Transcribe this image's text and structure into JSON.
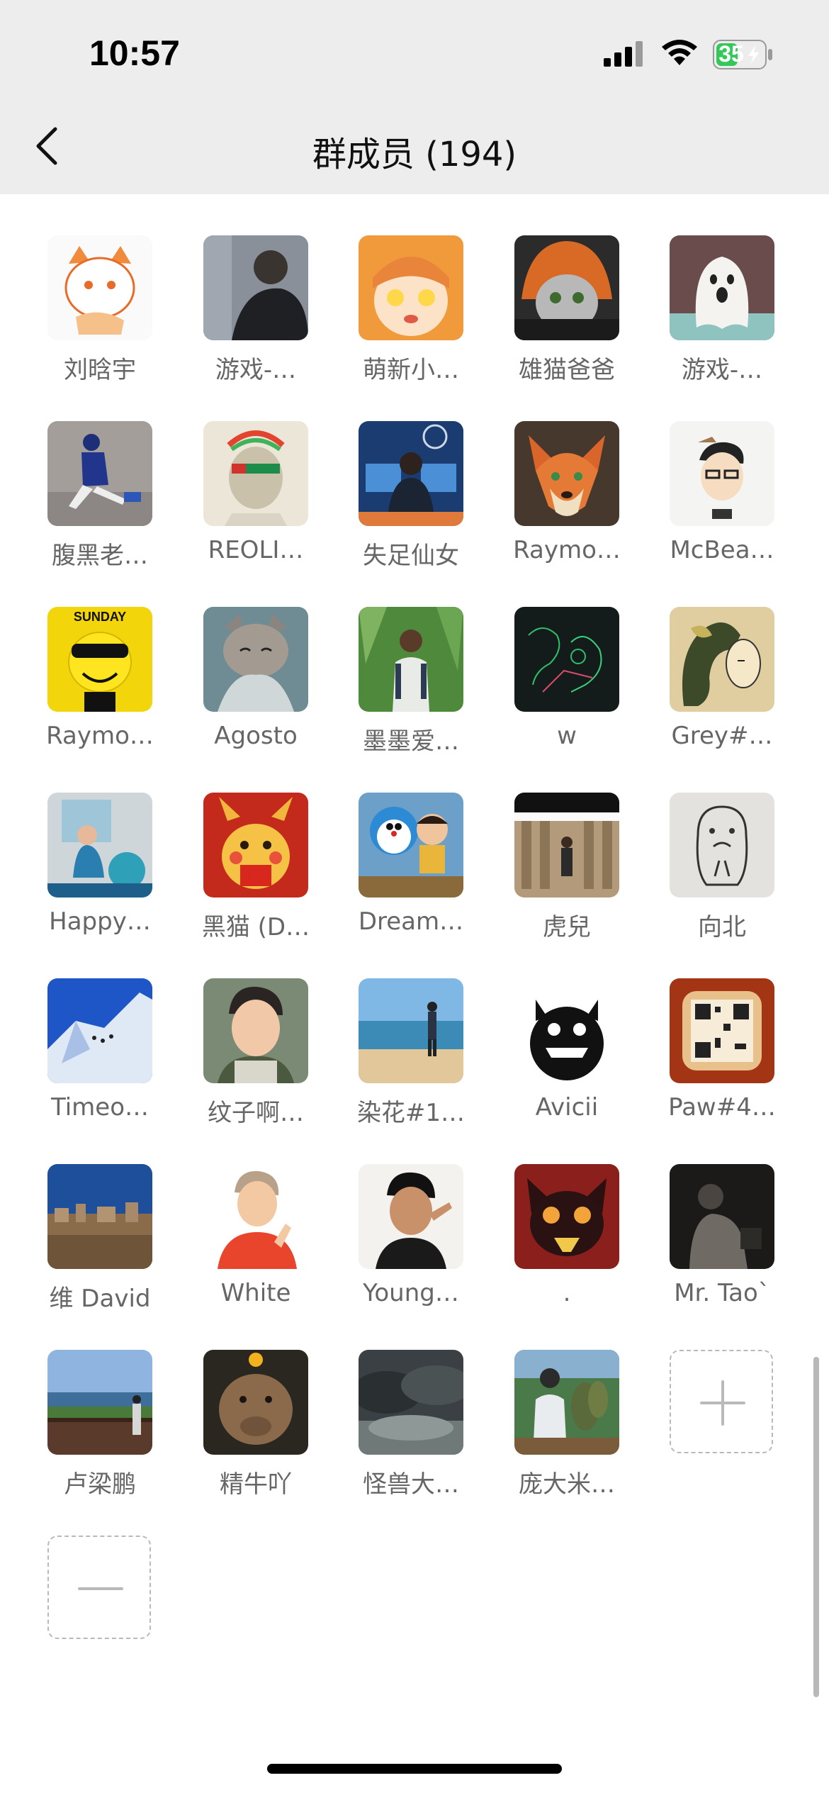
{
  "status_bar": {
    "time": "10:57",
    "battery": "35"
  },
  "nav": {
    "title": "群成员 (194)"
  },
  "members": [
    {
      "name": "刘晗宇",
      "avatar": "white-fox-cartoon-icon"
    },
    {
      "name": "游戏-…",
      "avatar": "person-hoodie-photo-icon"
    },
    {
      "name": "萌新小…",
      "avatar": "umaru-anime-icon"
    },
    {
      "name": "雄猫爸爸",
      "avatar": "cat-helmet-icon"
    },
    {
      "name": "游戏-…",
      "avatar": "ghost-icon"
    },
    {
      "name": "腹黑老…",
      "avatar": "sitting-figure-icon"
    },
    {
      "name": "REOLI…",
      "avatar": "ape-nft-icon"
    },
    {
      "name": "失足仙女",
      "avatar": "desk-computer-icon"
    },
    {
      "name": "Raymo…",
      "avatar": "fox-nick-icon"
    },
    {
      "name": "McBea…",
      "avatar": "glasses-man-cartoon-icon"
    },
    {
      "name": "Raymo…",
      "avatar": "sunday-smiley-icon"
    },
    {
      "name": "Agosto",
      "avatar": "tabby-cat-icon"
    },
    {
      "name": "墨墨爱…",
      "avatar": "person-greenery-icon"
    },
    {
      "name": "w",
      "avatar": "neon-sketch-icon"
    },
    {
      "name": "Grey#…",
      "avatar": "botanical-face-icon"
    },
    {
      "name": "Happy…",
      "avatar": "child-room-icon"
    },
    {
      "name": "黑猫 (D…",
      "avatar": "pikachu-icon"
    },
    {
      "name": "Dream…",
      "avatar": "doraemon-icon"
    },
    {
      "name": "虎兒",
      "avatar": "temple-columns-icon"
    },
    {
      "name": "向北",
      "avatar": "seal-doodle-icon"
    },
    {
      "name": "Timeo…",
      "avatar": "mountain-snow-icon"
    },
    {
      "name": "纹子啊…",
      "avatar": "young-man-selfie-icon"
    },
    {
      "name": "染花#1…",
      "avatar": "beach-person-icon"
    },
    {
      "name": "Avicii",
      "avatar": "black-monster-icon"
    },
    {
      "name": "Paw#4…",
      "avatar": "qr-toast-icon"
    },
    {
      "name": "维 David",
      "avatar": "city-sky-icon"
    },
    {
      "name": "White",
      "avatar": "anime-boy-icon"
    },
    {
      "name": "Young…",
      "avatar": "boy-pose-icon"
    },
    {
      "name": ".",
      "avatar": "red-cat-icon"
    },
    {
      "name": "Mr. Tao`",
      "avatar": "dark-portrait-icon"
    },
    {
      "name": "卢梁鹏",
      "avatar": "seaside-deck-icon"
    },
    {
      "name": "精牛吖",
      "avatar": "capybara-icon"
    },
    {
      "name": "怪兽大…",
      "avatar": "dark-clouds-icon"
    },
    {
      "name": "庞大米…",
      "avatar": "fisherman-icon"
    }
  ],
  "actions": {
    "add": "+",
    "remove": "—"
  }
}
